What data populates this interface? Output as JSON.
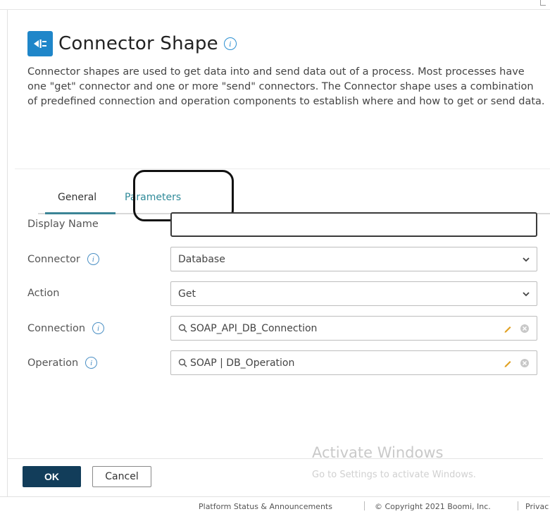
{
  "dialog": {
    "title": "Connector Shape",
    "description": "Connector shapes are used to get data into and send data out of a process. Most processes have one \"get\" connector and one or more \"send\" connectors. The Connector shape uses a combination of predefined connection and operation components to establish where and how to get or send data."
  },
  "tabs": [
    {
      "label": "General",
      "active": true
    },
    {
      "label": "Parameters",
      "active": false
    }
  ],
  "form": {
    "display_name": {
      "label": "Display Name",
      "value": ""
    },
    "connector": {
      "label": "Connector",
      "value": "Database"
    },
    "action": {
      "label": "Action",
      "value": "Get"
    },
    "connection": {
      "label": "Connection",
      "value": "SOAP_API_DB_Connection"
    },
    "operation": {
      "label": "Operation",
      "value": "SOAP | DB_Operation"
    }
  },
  "buttons": {
    "ok": "OK",
    "cancel": "Cancel"
  },
  "watermark": {
    "title": "Activate Windows",
    "subtitle": "Go to Settings to activate Windows."
  },
  "footer": {
    "status": "Platform Status & Announcements",
    "copyright": "© Copyright 2021 Boomi, Inc.",
    "privacy": "Privac"
  },
  "colors": {
    "accent": "#1f86c9",
    "tab_active": "#3b8596",
    "ok_button": "#123d5a"
  }
}
